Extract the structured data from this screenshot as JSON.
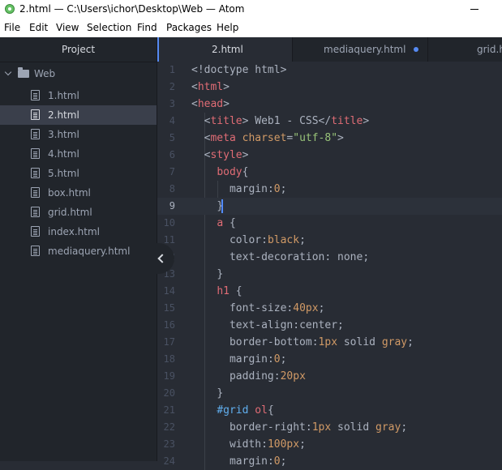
{
  "window": {
    "title": "2.html — C:\\Users\\ichor\\Desktop\\Web — Atom"
  },
  "menu": [
    "File",
    "Edit",
    "View",
    "Selection",
    "Find",
    "Packages",
    "Help"
  ],
  "tree": {
    "header": "Project",
    "root": "Web",
    "files": [
      "1.html",
      "2.html",
      "3.html",
      "4.html",
      "5.html",
      "box.html",
      "grid.html",
      "index.html",
      "mediaquery.html"
    ],
    "selected_index": 1
  },
  "tabs": [
    {
      "label": "2.html",
      "active": true,
      "modified": false
    },
    {
      "label": "mediaquery.html",
      "active": false,
      "modified": true
    },
    {
      "label": "grid.h",
      "active": false,
      "modified": false
    }
  ],
  "editor": {
    "cursor_line": 9,
    "lines": [
      {
        "n": "1",
        "tokens": [
          [
            "t-plain",
            "<!doctype html>"
          ]
        ]
      },
      {
        "n": "2",
        "tokens": [
          [
            "t-punc",
            "<"
          ],
          [
            "t-tag",
            "html"
          ],
          [
            "t-punc",
            ">"
          ]
        ]
      },
      {
        "n": "3",
        "tokens": [
          [
            "t-punc",
            "<"
          ],
          [
            "t-tag",
            "head"
          ],
          [
            "t-punc",
            ">"
          ]
        ]
      },
      {
        "n": "4",
        "tokens": [
          [
            "t-plain",
            "  "
          ],
          [
            "t-punc",
            "<"
          ],
          [
            "t-tag",
            "title"
          ],
          [
            "t-punc",
            ">"
          ],
          [
            "t-plain",
            " Web1 - CSS"
          ],
          [
            "t-punc",
            "</"
          ],
          [
            "t-tag",
            "title"
          ],
          [
            "t-punc",
            ">"
          ]
        ]
      },
      {
        "n": "5",
        "tokens": [
          [
            "t-plain",
            "  "
          ],
          [
            "t-punc",
            "<"
          ],
          [
            "t-tag",
            "meta"
          ],
          [
            "t-plain",
            " "
          ],
          [
            "t-attr",
            "charset"
          ],
          [
            "t-punc",
            "="
          ],
          [
            "t-str",
            "\"utf-8\""
          ],
          [
            "t-punc",
            ">"
          ]
        ]
      },
      {
        "n": "6",
        "tokens": [
          [
            "t-plain",
            "  "
          ],
          [
            "t-punc",
            "<"
          ],
          [
            "t-tag",
            "style"
          ],
          [
            "t-punc",
            ">"
          ]
        ]
      },
      {
        "n": "7",
        "tokens": [
          [
            "t-plain",
            "    "
          ],
          [
            "t-sel",
            "body"
          ],
          [
            "t-punc",
            "{"
          ]
        ]
      },
      {
        "n": "8",
        "tokens": [
          [
            "t-plain",
            "      "
          ],
          [
            "t-prop",
            "margin"
          ],
          [
            "t-punc",
            ":"
          ],
          [
            "t-num",
            "0"
          ],
          [
            "t-punc",
            ";"
          ]
        ]
      },
      {
        "n": "9",
        "tokens": [
          [
            "t-plain",
            "    "
          ],
          [
            "t-punc",
            "}"
          ]
        ]
      },
      {
        "n": "10",
        "tokens": [
          [
            "t-plain",
            "    "
          ],
          [
            "t-sel",
            "a"
          ],
          [
            "t-plain",
            " "
          ],
          [
            "t-punc",
            "{"
          ]
        ]
      },
      {
        "n": "11",
        "tokens": [
          [
            "t-plain",
            "      "
          ],
          [
            "t-prop",
            "color"
          ],
          [
            "t-punc",
            ":"
          ],
          [
            "t-val",
            "black"
          ],
          [
            "t-punc",
            ";"
          ]
        ]
      },
      {
        "n": "12",
        "tokens": [
          [
            "t-plain",
            "      "
          ],
          [
            "t-prop",
            "text-decoration"
          ],
          [
            "t-punc",
            ": "
          ],
          [
            "t-plain",
            "none"
          ],
          [
            "t-punc",
            ";"
          ]
        ]
      },
      {
        "n": "13",
        "tokens": [
          [
            "t-plain",
            "    "
          ],
          [
            "t-punc",
            "}"
          ]
        ]
      },
      {
        "n": "14",
        "tokens": [
          [
            "t-plain",
            "    "
          ],
          [
            "t-sel",
            "h1"
          ],
          [
            "t-plain",
            " "
          ],
          [
            "t-punc",
            "{"
          ]
        ]
      },
      {
        "n": "15",
        "tokens": [
          [
            "t-plain",
            "      "
          ],
          [
            "t-prop",
            "font-size"
          ],
          [
            "t-punc",
            ":"
          ],
          [
            "t-num",
            "40px"
          ],
          [
            "t-punc",
            ";"
          ]
        ]
      },
      {
        "n": "16",
        "tokens": [
          [
            "t-plain",
            "      "
          ],
          [
            "t-prop",
            "text-align"
          ],
          [
            "t-punc",
            ":"
          ],
          [
            "t-plain",
            "center"
          ],
          [
            "t-punc",
            ";"
          ]
        ]
      },
      {
        "n": "17",
        "tokens": [
          [
            "t-plain",
            "      "
          ],
          [
            "t-prop",
            "border-bottom"
          ],
          [
            "t-punc",
            ":"
          ],
          [
            "t-num",
            "1px"
          ],
          [
            "t-plain",
            " solid "
          ],
          [
            "t-val",
            "gray"
          ],
          [
            "t-punc",
            ";"
          ]
        ]
      },
      {
        "n": "18",
        "tokens": [
          [
            "t-plain",
            "      "
          ],
          [
            "t-prop",
            "margin"
          ],
          [
            "t-punc",
            ":"
          ],
          [
            "t-num",
            "0"
          ],
          [
            "t-punc",
            ";"
          ]
        ]
      },
      {
        "n": "19",
        "tokens": [
          [
            "t-plain",
            "      "
          ],
          [
            "t-prop",
            "padding"
          ],
          [
            "t-punc",
            ":"
          ],
          [
            "t-num",
            "20px"
          ]
        ]
      },
      {
        "n": "20",
        "tokens": [
          [
            "t-plain",
            "    "
          ],
          [
            "t-punc",
            "}"
          ]
        ]
      },
      {
        "n": "21",
        "tokens": [
          [
            "t-plain",
            "    "
          ],
          [
            "t-id",
            "#grid"
          ],
          [
            "t-plain",
            " "
          ],
          [
            "t-sel",
            "ol"
          ],
          [
            "t-punc",
            "{"
          ]
        ]
      },
      {
        "n": "22",
        "tokens": [
          [
            "t-plain",
            "      "
          ],
          [
            "t-prop",
            "border-right"
          ],
          [
            "t-punc",
            ":"
          ],
          [
            "t-num",
            "1px"
          ],
          [
            "t-plain",
            " solid "
          ],
          [
            "t-val",
            "gray"
          ],
          [
            "t-punc",
            ";"
          ]
        ]
      },
      {
        "n": "23",
        "tokens": [
          [
            "t-plain",
            "      "
          ],
          [
            "t-prop",
            "width"
          ],
          [
            "t-punc",
            ":"
          ],
          [
            "t-num",
            "100px"
          ],
          [
            "t-punc",
            ";"
          ]
        ]
      },
      {
        "n": "24",
        "tokens": [
          [
            "t-plain",
            "      "
          ],
          [
            "t-prop",
            "margin"
          ],
          [
            "t-punc",
            ":"
          ],
          [
            "t-num",
            "0"
          ],
          [
            "t-punc",
            ";"
          ]
        ]
      }
    ]
  }
}
